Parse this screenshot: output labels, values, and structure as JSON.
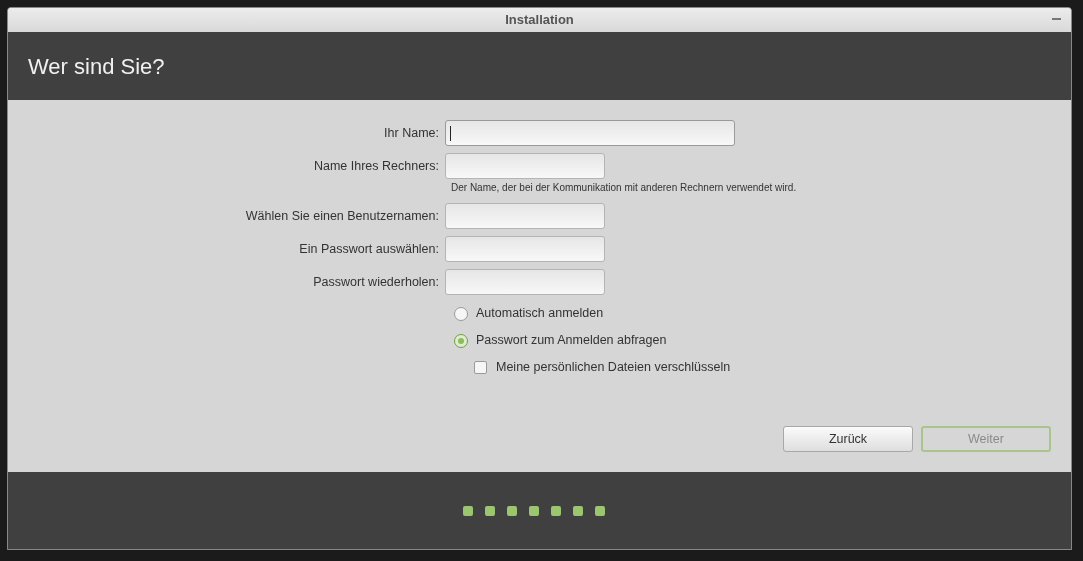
{
  "window": {
    "title": "Installation"
  },
  "header": {
    "title": "Wer sind Sie?"
  },
  "fields": [
    {
      "label": "Ihr Name:",
      "kind": "wide",
      "focused": true
    },
    {
      "label": "Name Ihres Rechners:",
      "kind": "short",
      "focused": false,
      "hint": "Der Name, der bei der Kommunikation mit anderen Rechnern verwendet wird."
    },
    {
      "label": "Wählen Sie einen Benutzernamen:",
      "kind": "short",
      "focused": false
    },
    {
      "label": "Ein Passwort auswählen:",
      "kind": "short",
      "focused": false
    },
    {
      "label": "Passwort wiederholen:",
      "kind": "short",
      "focused": false
    }
  ],
  "login_options": [
    {
      "label": "Automatisch anmelden",
      "selected": false
    },
    {
      "label": "Passwort zum Anmelden abfragen",
      "selected": true
    }
  ],
  "encrypt": {
    "label": "Meine persönlichen Dateien verschlüsseln",
    "checked": false
  },
  "buttons": [
    {
      "label": "Zurück",
      "disabled": false
    },
    {
      "label": "Weiter",
      "disabled": true
    }
  ]
}
